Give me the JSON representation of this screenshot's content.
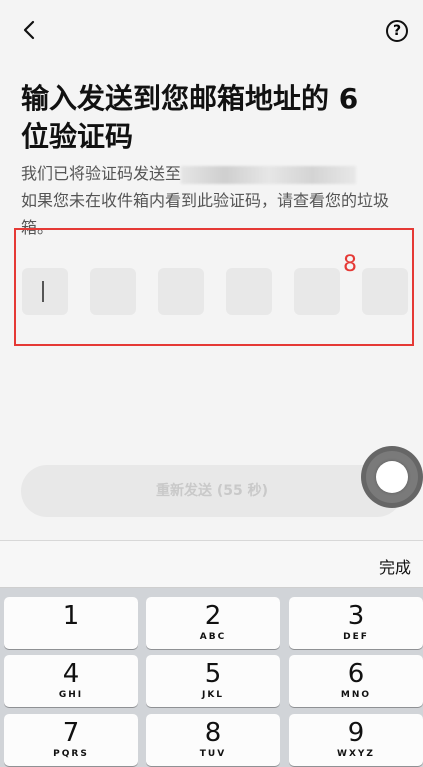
{
  "header": {
    "back_icon": "chevron-left-icon",
    "help_icon": "question-circle-icon",
    "help_symbol": "?"
  },
  "title": "输入发送到您邮箱地址的 6 位验证码",
  "desc": {
    "line1_prefix": "我们已将验证码发送至",
    "rest": "如果您未在收件箱内看到此验证码，请查看您的垃圾箱。"
  },
  "annotation": {
    "marker": "8"
  },
  "resend": {
    "label": "重新发送 (55 秒)"
  },
  "keyboard": {
    "done_label": "完成",
    "keys": [
      {
        "digit": "1",
        "letters": ""
      },
      {
        "digit": "2",
        "letters": "ABC"
      },
      {
        "digit": "3",
        "letters": "DEF"
      },
      {
        "digit": "4",
        "letters": "GHI"
      },
      {
        "digit": "5",
        "letters": "JKL"
      },
      {
        "digit": "6",
        "letters": "MNO"
      },
      {
        "digit": "7",
        "letters": "PQRS"
      },
      {
        "digit": "8",
        "letters": "TUV"
      },
      {
        "digit": "9",
        "letters": "WXYZ"
      }
    ]
  }
}
